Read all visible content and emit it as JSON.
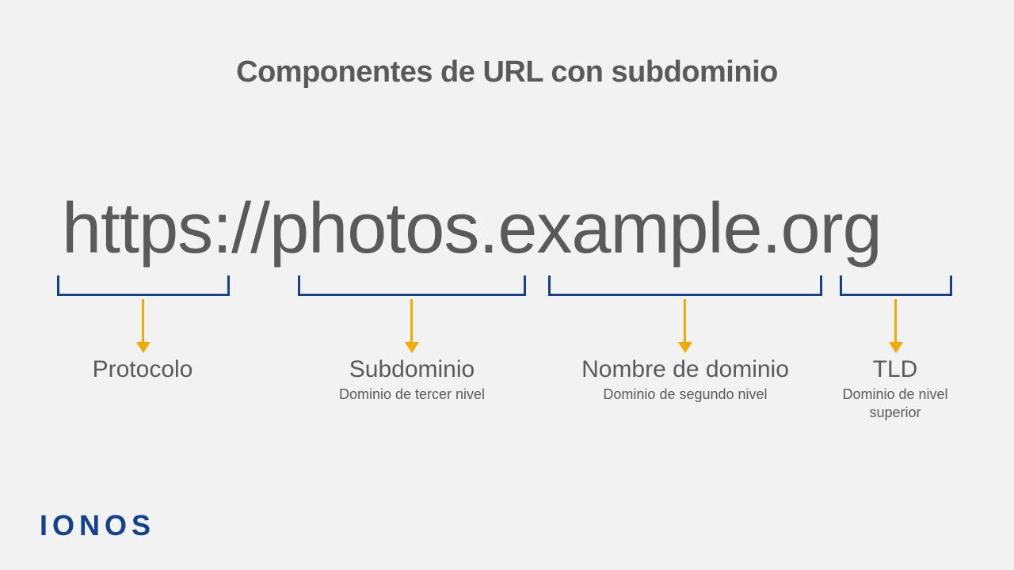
{
  "title": "Componentes de URL con subdominio",
  "url": "https://photos.example.org",
  "labels": {
    "protocol": {
      "main": "Protocolo",
      "sub": ""
    },
    "subdomain": {
      "main": "Subdominio",
      "sub": "Dominio de tercer nivel"
    },
    "domain": {
      "main": "Nombre de dominio",
      "sub": "Dominio de segundo nivel"
    },
    "tld": {
      "main": "TLD",
      "sub": "Dominio de nivel superior"
    }
  },
  "logo": "IONOS"
}
